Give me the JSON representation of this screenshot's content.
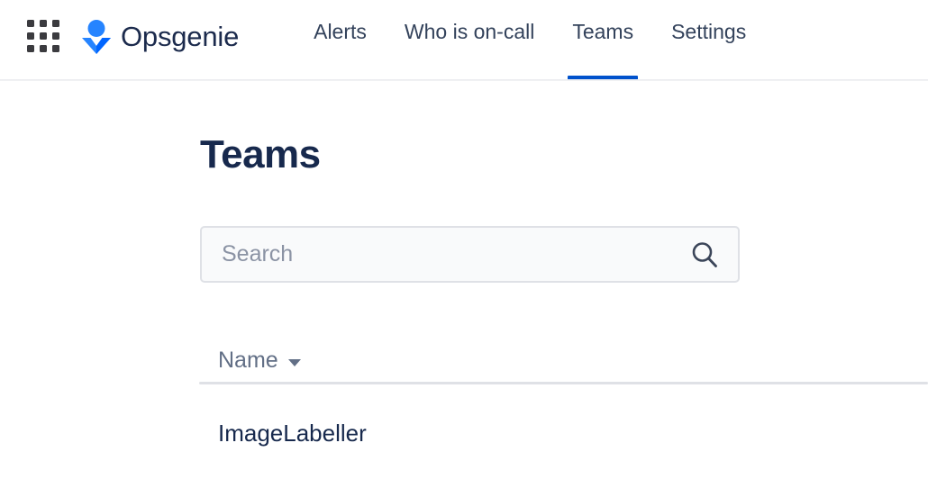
{
  "brand": {
    "app_switcher_icon": "grid-apps-icon",
    "logo_icon": "opsgenie-logo-icon",
    "name": "Opsgenie",
    "logo_color": "#2684ff",
    "logo_color_dark": "#0052cc",
    "wordmark_color": "#1c2b4d"
  },
  "nav": {
    "active": "Teams",
    "active_underline_color": "#0052cc",
    "items": [
      {
        "label": "Alerts",
        "active": false
      },
      {
        "label": "Who is on-call",
        "active": false
      },
      {
        "label": "Teams",
        "active": true
      },
      {
        "label": "Settings",
        "active": false
      }
    ]
  },
  "page": {
    "title": "Teams"
  },
  "search": {
    "placeholder": "Search",
    "value": "",
    "icon": "search-icon",
    "background": "#f9fafb",
    "border_color": "#dfe1e6"
  },
  "table": {
    "columns": [
      {
        "label": "Name",
        "sort_icon": "caret-down-icon",
        "sorted": true
      }
    ],
    "rows": [
      {
        "name": "ImageLabeller"
      }
    ]
  }
}
